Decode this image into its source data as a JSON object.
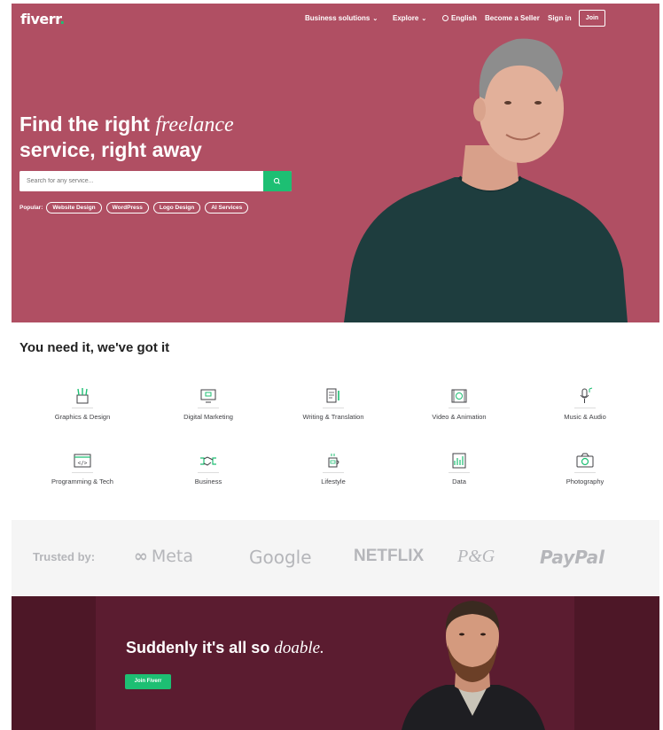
{
  "nav": {
    "logo": "fiverr",
    "logo_dot": ".",
    "business_solutions": "Business solutions",
    "explore": "Explore",
    "language": "English",
    "become_seller": "Become a Seller",
    "sign_in": "Sign in",
    "join": "Join"
  },
  "hero": {
    "title_line1": "Find the right",
    "title_em": "freelance",
    "title_line2": "service, right away",
    "search_placeholder": "Search for any service...",
    "popular_label": "Popular:",
    "popular_tags": [
      "Website Design",
      "WordPress",
      "Logo Design",
      "AI Services"
    ]
  },
  "categories": {
    "title": "You need it, we've got it",
    "items": [
      {
        "label": "Graphics & Design",
        "icon": "graphics-design-icon"
      },
      {
        "label": "Digital Marketing",
        "icon": "digital-marketing-icon"
      },
      {
        "label": "Writing & Translation",
        "icon": "writing-translation-icon"
      },
      {
        "label": "Video & Animation",
        "icon": "video-animation-icon"
      },
      {
        "label": "Music & Audio",
        "icon": "music-audio-icon"
      },
      {
        "label": "Programming & Tech",
        "icon": "programming-tech-icon"
      },
      {
        "label": "Business",
        "icon": "business-icon"
      },
      {
        "label": "Lifestyle",
        "icon": "lifestyle-icon"
      },
      {
        "label": "Data",
        "icon": "data-icon"
      },
      {
        "label": "Photography",
        "icon": "photography-icon"
      }
    ]
  },
  "trusted": {
    "label": "Trusted by:",
    "brands": [
      "Meta",
      "Google",
      "NETFLIX",
      "P&G",
      "PayPal"
    ]
  },
  "banner": {
    "title": "Suddenly it's all so",
    "title_em": "doable.",
    "button": "Join Fiverr"
  },
  "colors": {
    "hero_bg": "#b04f63",
    "accent_green": "#1dbf73",
    "banner_bg": "#5b1c30",
    "trusted_bg": "#f5f5f5"
  }
}
